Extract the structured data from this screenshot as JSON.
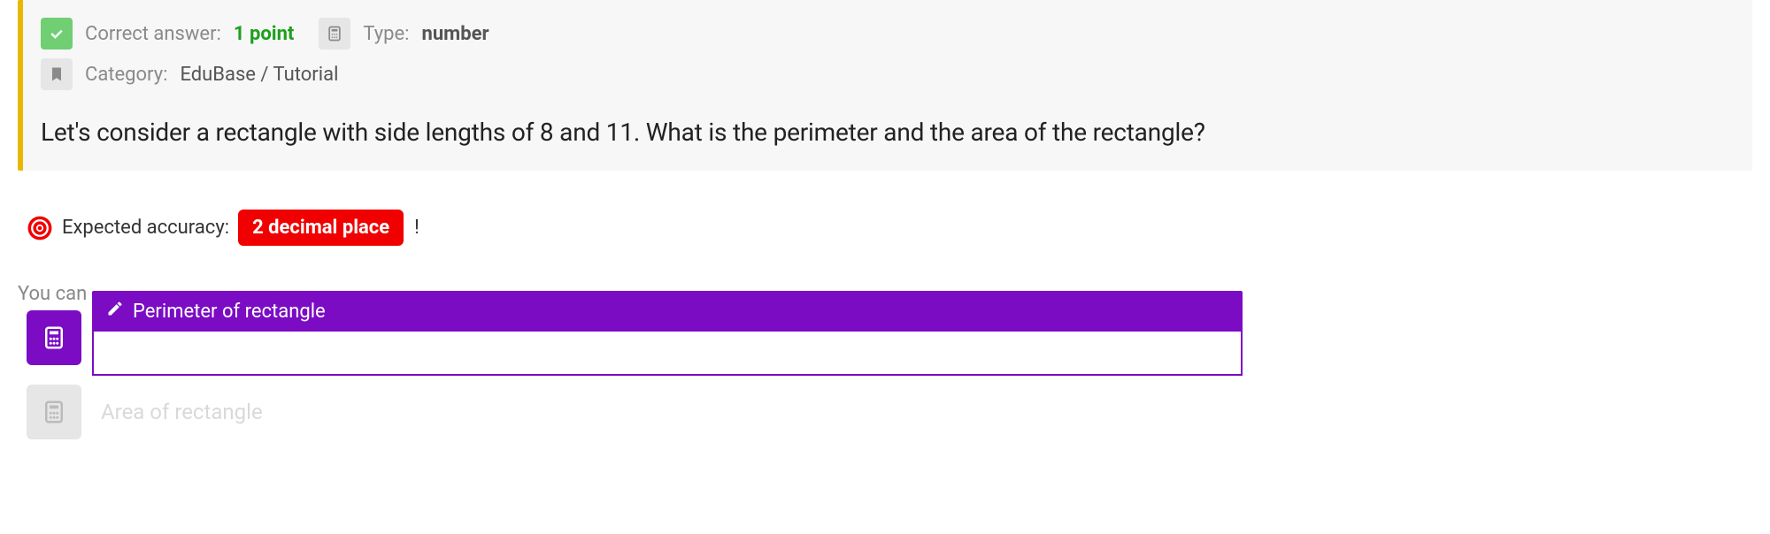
{
  "header": {
    "correct_label": "Correct answer:",
    "points": "1 point",
    "type_label": "Type:",
    "type_value": "number",
    "category_label": "Category:",
    "category_value": "EduBase / Tutorial"
  },
  "question": "Let's consider a rectangle with side lengths of 8 and 11. What is the perimeter and the area of the rectangle?",
  "accuracy": {
    "label": "Expected accuracy:",
    "value": "2 decimal place",
    "excl": "!"
  },
  "hint": "You can",
  "answers": {
    "perimeter_label": "Perimeter of rectangle",
    "perimeter_value": "",
    "area_label": "Area of rectangle"
  }
}
